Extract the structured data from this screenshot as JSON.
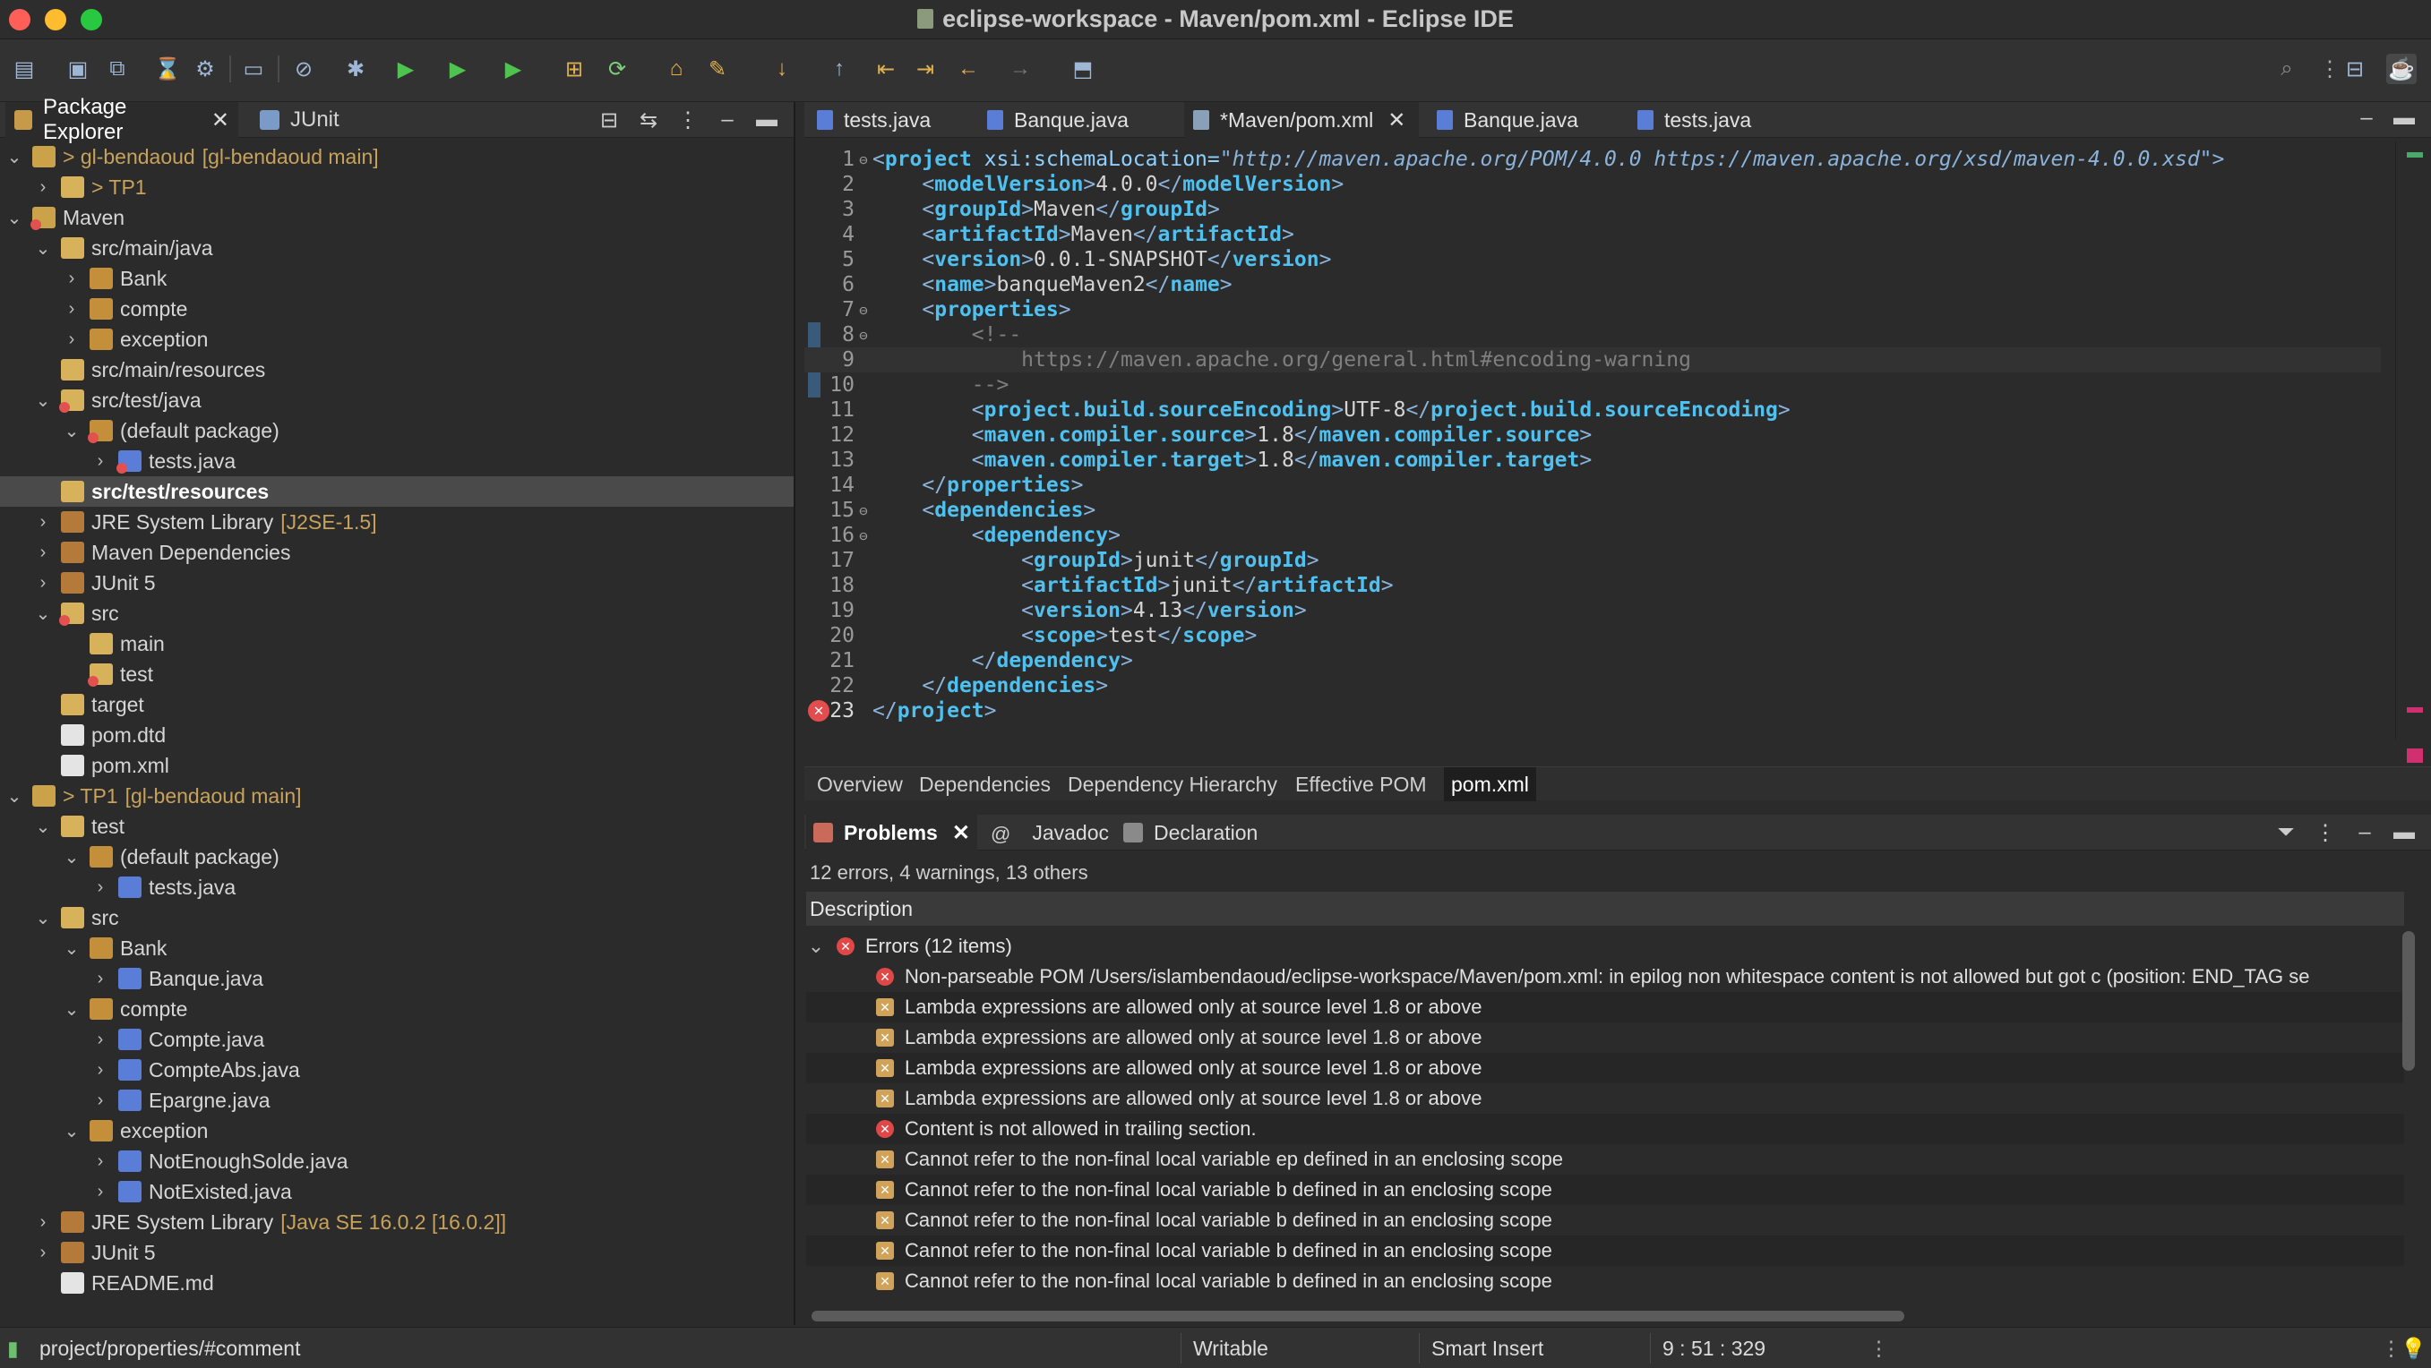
{
  "window": {
    "title": "eclipse-workspace - Maven/pom.xml - Eclipse IDE"
  },
  "left_tabs": {
    "package_explorer": "Package Explorer",
    "junit": "JUnit"
  },
  "tree": [
    {
      "label": "> gl-bendaoud",
      "suffix": "[gl-bendaoud main]",
      "depth": 0,
      "expanded": true,
      "icon": "project"
    },
    {
      "label": "> TP1",
      "suffix": "",
      "depth": 1,
      "expanded": false,
      "icon": "folder"
    },
    {
      "label": "Maven",
      "suffix": "",
      "depth": 0,
      "expanded": true,
      "icon": "project-error"
    },
    {
      "label": "src/main/java",
      "suffix": "",
      "depth": 1,
      "expanded": true,
      "icon": "folder"
    },
    {
      "label": "Bank",
      "suffix": "",
      "depth": 2,
      "expanded": false,
      "icon": "package"
    },
    {
      "label": "compte",
      "suffix": "",
      "depth": 2,
      "expanded": false,
      "icon": "package"
    },
    {
      "label": "exception",
      "suffix": "",
      "depth": 2,
      "expanded": false,
      "icon": "package"
    },
    {
      "label": "src/main/resources",
      "suffix": "",
      "depth": 1,
      "expanded": null,
      "icon": "folder"
    },
    {
      "label": "src/test/java",
      "suffix": "",
      "depth": 1,
      "expanded": true,
      "icon": "folder-error"
    },
    {
      "label": "(default package)",
      "suffix": "",
      "depth": 2,
      "expanded": true,
      "icon": "package-error"
    },
    {
      "label": "tests.java",
      "suffix": "",
      "depth": 3,
      "expanded": false,
      "icon": "java-error"
    },
    {
      "label": "src/test/resources",
      "suffix": "",
      "depth": 1,
      "expanded": null,
      "icon": "folder",
      "selected": true
    },
    {
      "label": "JRE System Library",
      "suffix": "[J2SE-1.5]",
      "depth": 1,
      "expanded": false,
      "icon": "library"
    },
    {
      "label": "Maven Dependencies",
      "suffix": "",
      "depth": 1,
      "expanded": false,
      "icon": "library"
    },
    {
      "label": "JUnit 5",
      "suffix": "",
      "depth": 1,
      "expanded": false,
      "icon": "library"
    },
    {
      "label": "src",
      "suffix": "",
      "depth": 1,
      "expanded": true,
      "icon": "folder-error"
    },
    {
      "label": "main",
      "suffix": "",
      "depth": 2,
      "expanded": null,
      "icon": "folder"
    },
    {
      "label": "test",
      "suffix": "",
      "depth": 2,
      "expanded": null,
      "icon": "folder-error"
    },
    {
      "label": "target",
      "suffix": "",
      "depth": 1,
      "expanded": null,
      "icon": "folder"
    },
    {
      "label": "pom.dtd",
      "suffix": "",
      "depth": 1,
      "expanded": null,
      "icon": "xml"
    },
    {
      "label": "pom.xml",
      "suffix": "",
      "depth": 1,
      "expanded": null,
      "icon": "xml"
    },
    {
      "label": "> TP1",
      "suffix": "[gl-bendaoud main]",
      "depth": 0,
      "expanded": true,
      "icon": "project"
    },
    {
      "label": "test",
      "suffix": "",
      "depth": 1,
      "expanded": true,
      "icon": "folder"
    },
    {
      "label": "(default package)",
      "suffix": "",
      "depth": 2,
      "expanded": true,
      "icon": "package"
    },
    {
      "label": "tests.java",
      "suffix": "",
      "depth": 3,
      "expanded": false,
      "icon": "java"
    },
    {
      "label": "src",
      "suffix": "",
      "depth": 1,
      "expanded": true,
      "icon": "folder"
    },
    {
      "label": "Bank",
      "suffix": "",
      "depth": 2,
      "expanded": true,
      "icon": "package"
    },
    {
      "label": "Banque.java",
      "suffix": "",
      "depth": 3,
      "expanded": false,
      "icon": "java"
    },
    {
      "label": "compte",
      "suffix": "",
      "depth": 2,
      "expanded": true,
      "icon": "package"
    },
    {
      "label": "Compte.java",
      "suffix": "",
      "depth": 3,
      "expanded": false,
      "icon": "java"
    },
    {
      "label": "CompteAbs.java",
      "suffix": "",
      "depth": 3,
      "expanded": false,
      "icon": "java"
    },
    {
      "label": "Epargne.java",
      "suffix": "",
      "depth": 3,
      "expanded": false,
      "icon": "java"
    },
    {
      "label": "exception",
      "suffix": "",
      "depth": 2,
      "expanded": true,
      "icon": "package"
    },
    {
      "label": "NotEnoughSolde.java",
      "suffix": "",
      "depth": 3,
      "expanded": false,
      "icon": "java"
    },
    {
      "label": "NotExisted.java",
      "suffix": "",
      "depth": 3,
      "expanded": false,
      "icon": "java"
    },
    {
      "label": "JRE System Library",
      "suffix": "[Java SE 16.0.2 [16.0.2]]",
      "depth": 1,
      "expanded": false,
      "icon": "library"
    },
    {
      "label": "JUnit 5",
      "suffix": "",
      "depth": 1,
      "expanded": false,
      "icon": "library"
    },
    {
      "label": "README.md",
      "suffix": "",
      "depth": 1,
      "expanded": null,
      "icon": "file"
    }
  ],
  "editor_tabs": [
    {
      "label": "tests.java",
      "active": false,
      "icon": "java"
    },
    {
      "label": "Banque.java",
      "active": false,
      "icon": "java"
    },
    {
      "label": "*Maven/pom.xml",
      "active": true,
      "icon": "xml"
    },
    {
      "label": "Banque.java",
      "active": false,
      "icon": "java"
    },
    {
      "label": "tests.java",
      "active": false,
      "icon": "java"
    }
  ],
  "code_lines": [
    {
      "n": "1",
      "fold": true,
      "parts": [
        [
          "t",
          "<"
        ],
        [
          "tn",
          "project"
        ],
        [
          "ta",
          " xsi:schemaLocation="
        ],
        [
          "tv",
          "\"http://maven.apache.org/POM/4.0.0 https://maven.apache.org/xsd/maven-4.0.0.xsd\""
        ],
        [
          "t",
          ">"
        ]
      ]
    },
    {
      "n": "2",
      "parts": [
        [
          "t",
          "    <"
        ],
        [
          "tn",
          "modelVersion"
        ],
        [
          "t",
          ">"
        ],
        [
          "x",
          "4.0.0"
        ],
        [
          "t",
          "</"
        ],
        [
          "tn",
          "modelVersion"
        ],
        [
          "t",
          ">"
        ]
      ]
    },
    {
      "n": "3",
      "parts": [
        [
          "t",
          "    <"
        ],
        [
          "tn",
          "groupId"
        ],
        [
          "t",
          ">"
        ],
        [
          "x",
          "Maven"
        ],
        [
          "t",
          "</"
        ],
        [
          "tn",
          "groupId"
        ],
        [
          "t",
          ">"
        ]
      ]
    },
    {
      "n": "4",
      "parts": [
        [
          "t",
          "    <"
        ],
        [
          "tn",
          "artifactId"
        ],
        [
          "t",
          ">"
        ],
        [
          "x",
          "Maven"
        ],
        [
          "t",
          "</"
        ],
        [
          "tn",
          "artifactId"
        ],
        [
          "t",
          ">"
        ]
      ]
    },
    {
      "n": "5",
      "parts": [
        [
          "t",
          "    <"
        ],
        [
          "tn",
          "version"
        ],
        [
          "t",
          ">"
        ],
        [
          "x",
          "0.0.1-SNAPSHOT"
        ],
        [
          "t",
          "</"
        ],
        [
          "tn",
          "version"
        ],
        [
          "t",
          ">"
        ]
      ]
    },
    {
      "n": "6",
      "parts": [
        [
          "t",
          "    <"
        ],
        [
          "tn",
          "name"
        ],
        [
          "t",
          ">"
        ],
        [
          "x",
          "banqueMaven2"
        ],
        [
          "t",
          "</"
        ],
        [
          "tn",
          "name"
        ],
        [
          "t",
          ">"
        ]
      ]
    },
    {
      "n": "7",
      "fold": true,
      "parts": [
        [
          "t",
          "    <"
        ],
        [
          "tn",
          "properties"
        ],
        [
          "t",
          ">"
        ]
      ]
    },
    {
      "n": "8",
      "fold": true,
      "parts": [
        [
          "cm",
          "        <!--"
        ]
      ]
    },
    {
      "n": "9",
      "cur": true,
      "parts": [
        [
          "cm",
          "            https://maven.apache.org/general.html#encoding-warning"
        ]
      ]
    },
    {
      "n": "10",
      "parts": [
        [
          "cm",
          "        -->"
        ]
      ]
    },
    {
      "n": "11",
      "parts": [
        [
          "t",
          "        <"
        ],
        [
          "tn",
          "project.build.sourceEncoding"
        ],
        [
          "t",
          ">"
        ],
        [
          "x",
          "UTF-8"
        ],
        [
          "t",
          "</"
        ],
        [
          "tn",
          "project.build.sourceEncoding"
        ],
        [
          "t",
          ">"
        ]
      ]
    },
    {
      "n": "12",
      "parts": [
        [
          "t",
          "        <"
        ],
        [
          "tn",
          "maven.compiler.source"
        ],
        [
          "t",
          ">"
        ],
        [
          "x",
          "1.8"
        ],
        [
          "t",
          "</"
        ],
        [
          "tn",
          "maven.compiler.source"
        ],
        [
          "t",
          ">"
        ]
      ]
    },
    {
      "n": "13",
      "parts": [
        [
          "t",
          "        <"
        ],
        [
          "tn",
          "maven.compiler.target"
        ],
        [
          "t",
          ">"
        ],
        [
          "x",
          "1.8"
        ],
        [
          "t",
          "</"
        ],
        [
          "tn",
          "maven.compiler.target"
        ],
        [
          "t",
          ">"
        ]
      ]
    },
    {
      "n": "14",
      "parts": [
        [
          "t",
          "    </"
        ],
        [
          "tn",
          "properties"
        ],
        [
          "t",
          ">"
        ]
      ]
    },
    {
      "n": "15",
      "fold": true,
      "parts": [
        [
          "t",
          "    <"
        ],
        [
          "tn",
          "dependencies"
        ],
        [
          "t",
          ">"
        ]
      ]
    },
    {
      "n": "16",
      "fold": true,
      "parts": [
        [
          "t",
          "        <"
        ],
        [
          "tn",
          "dependency"
        ],
        [
          "t",
          ">"
        ]
      ]
    },
    {
      "n": "17",
      "parts": [
        [
          "t",
          "            <"
        ],
        [
          "tn",
          "groupId"
        ],
        [
          "t",
          ">"
        ],
        [
          "x",
          "junit"
        ],
        [
          "t",
          "</"
        ],
        [
          "tn",
          "groupId"
        ],
        [
          "t",
          ">"
        ]
      ]
    },
    {
      "n": "18",
      "parts": [
        [
          "t",
          "            <"
        ],
        [
          "tn",
          "artifactId"
        ],
        [
          "t",
          ">"
        ],
        [
          "x",
          "junit"
        ],
        [
          "t",
          "</"
        ],
        [
          "tn",
          "artifactId"
        ],
        [
          "t",
          ">"
        ]
      ]
    },
    {
      "n": "19",
      "parts": [
        [
          "t",
          "            <"
        ],
        [
          "tn",
          "version"
        ],
        [
          "t",
          ">"
        ],
        [
          "x",
          "4.13"
        ],
        [
          "t",
          "</"
        ],
        [
          "tn",
          "version"
        ],
        [
          "t",
          ">"
        ]
      ]
    },
    {
      "n": "20",
      "parts": [
        [
          "t",
          "            <"
        ],
        [
          "tn",
          "scope"
        ],
        [
          "t",
          ">"
        ],
        [
          "x",
          "test"
        ],
        [
          "t",
          "</"
        ],
        [
          "tn",
          "scope"
        ],
        [
          "t",
          ">"
        ]
      ]
    },
    {
      "n": "21",
      "parts": [
        [
          "t",
          "        </"
        ],
        [
          "tn",
          "dependency"
        ],
        [
          "t",
          ">"
        ]
      ]
    },
    {
      "n": "22",
      "parts": [
        [
          "t",
          "    </"
        ],
        [
          "tn",
          "dependencies"
        ],
        [
          "t",
          ">"
        ]
      ]
    },
    {
      "n": "23",
      "error": true,
      "parts": [
        [
          "t",
          "</"
        ],
        [
          "tn",
          "project"
        ],
        [
          "t",
          ">"
        ]
      ]
    }
  ],
  "pom_tabs": [
    {
      "label": "Overview",
      "active": false
    },
    {
      "label": "Dependencies",
      "active": false
    },
    {
      "label": "Dependency Hierarchy",
      "active": false
    },
    {
      "label": "Effective POM",
      "active": false
    },
    {
      "label": "pom.xml",
      "active": true
    }
  ],
  "problems": {
    "tabs": {
      "problems": "Problems",
      "javadoc": "Javadoc",
      "declaration": "Declaration"
    },
    "summary": "12 errors, 4 warnings, 13 others",
    "column": "Description",
    "group": "Errors (12 items)",
    "items": [
      {
        "kind": "error",
        "text": "Non-parseable POM /Users/islambendaoud/eclipse-workspace/Maven/pom.xml: in epilog non whitespace content is not allowed but got c (position: END_TAG se"
      },
      {
        "kind": "java",
        "text": "Lambda expressions are allowed only at source level 1.8 or above"
      },
      {
        "kind": "java",
        "text": "Lambda expressions are allowed only at source level 1.8 or above"
      },
      {
        "kind": "java",
        "text": "Lambda expressions are allowed only at source level 1.8 or above"
      },
      {
        "kind": "java",
        "text": "Lambda expressions are allowed only at source level 1.8 or above"
      },
      {
        "kind": "error",
        "text": "Content is not allowed in trailing section."
      },
      {
        "kind": "java",
        "text": "Cannot refer to the non-final local variable ep defined in an enclosing scope"
      },
      {
        "kind": "java",
        "text": "Cannot refer to the non-final local variable b defined in an enclosing scope"
      },
      {
        "kind": "java",
        "text": "Cannot refer to the non-final local variable b defined in an enclosing scope"
      },
      {
        "kind": "java",
        "text": "Cannot refer to the non-final local variable b defined in an enclosing scope"
      },
      {
        "kind": "java",
        "text": "Cannot refer to the non-final local variable b defined in an enclosing scope"
      }
    ]
  },
  "status": {
    "path": "project/properties/#comment",
    "writable": "Writable",
    "insert_mode": "Smart Insert",
    "position": "9 : 51 : 329"
  }
}
